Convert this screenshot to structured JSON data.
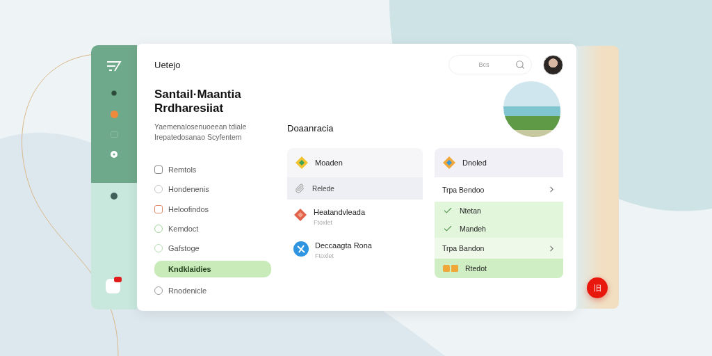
{
  "header": {
    "title": "Uetejo",
    "search": {
      "placeholder": "Bcs"
    }
  },
  "intro": {
    "title": "Santail·Maantia Rrdharesiiat",
    "subtitle": "Yaemenalosenuoeean tdiale Irepatedosanao Scyfentem"
  },
  "nav": [
    {
      "label": "Remtols",
      "kind": "square",
      "color": "#8a8a8a",
      "selected": false
    },
    {
      "label": "Hondenenis",
      "kind": "circle",
      "color": "#c4c4c4",
      "selected": false
    },
    {
      "label": "Heloofindos",
      "kind": "square",
      "color": "#e08a6c",
      "selected": false
    },
    {
      "label": "Kemdoct",
      "kind": "circle",
      "color": "#9fd39a",
      "selected": false
    },
    {
      "label": "Gafstoge",
      "kind": "circle",
      "color": "#b5dfb0",
      "selected": false
    },
    {
      "label": "Kndklaidies",
      "kind": "none",
      "selected": true
    },
    {
      "label": "Rnodenicle",
      "kind": "circle",
      "color": "#9a9a9a",
      "selected": false
    }
  ],
  "section": {
    "title": "Doaanracia"
  },
  "left_card": {
    "header": "Moaden",
    "subheader": "Relede",
    "items": [
      {
        "title": "Heatandvleada",
        "subtitle": "Ftoxlet",
        "kind": "diamond"
      },
      {
        "title": "Deccaagta Rona",
        "subtitle": "Ftoxlet",
        "kind": "circle"
      }
    ]
  },
  "right_card": {
    "header": "Dnoled",
    "rows": [
      {
        "kind": "link",
        "label": "Trpa Bendoo",
        "highlighted": false
      },
      {
        "kind": "check",
        "label": "Ntetan",
        "checked": true
      },
      {
        "kind": "check",
        "label": "Mandeh",
        "checked": true
      },
      {
        "kind": "link",
        "label": "Trpa Bandon",
        "highlighted": true
      },
      {
        "kind": "badge",
        "label": "Rtedot"
      }
    ]
  },
  "fab": {
    "label": "旧"
  }
}
